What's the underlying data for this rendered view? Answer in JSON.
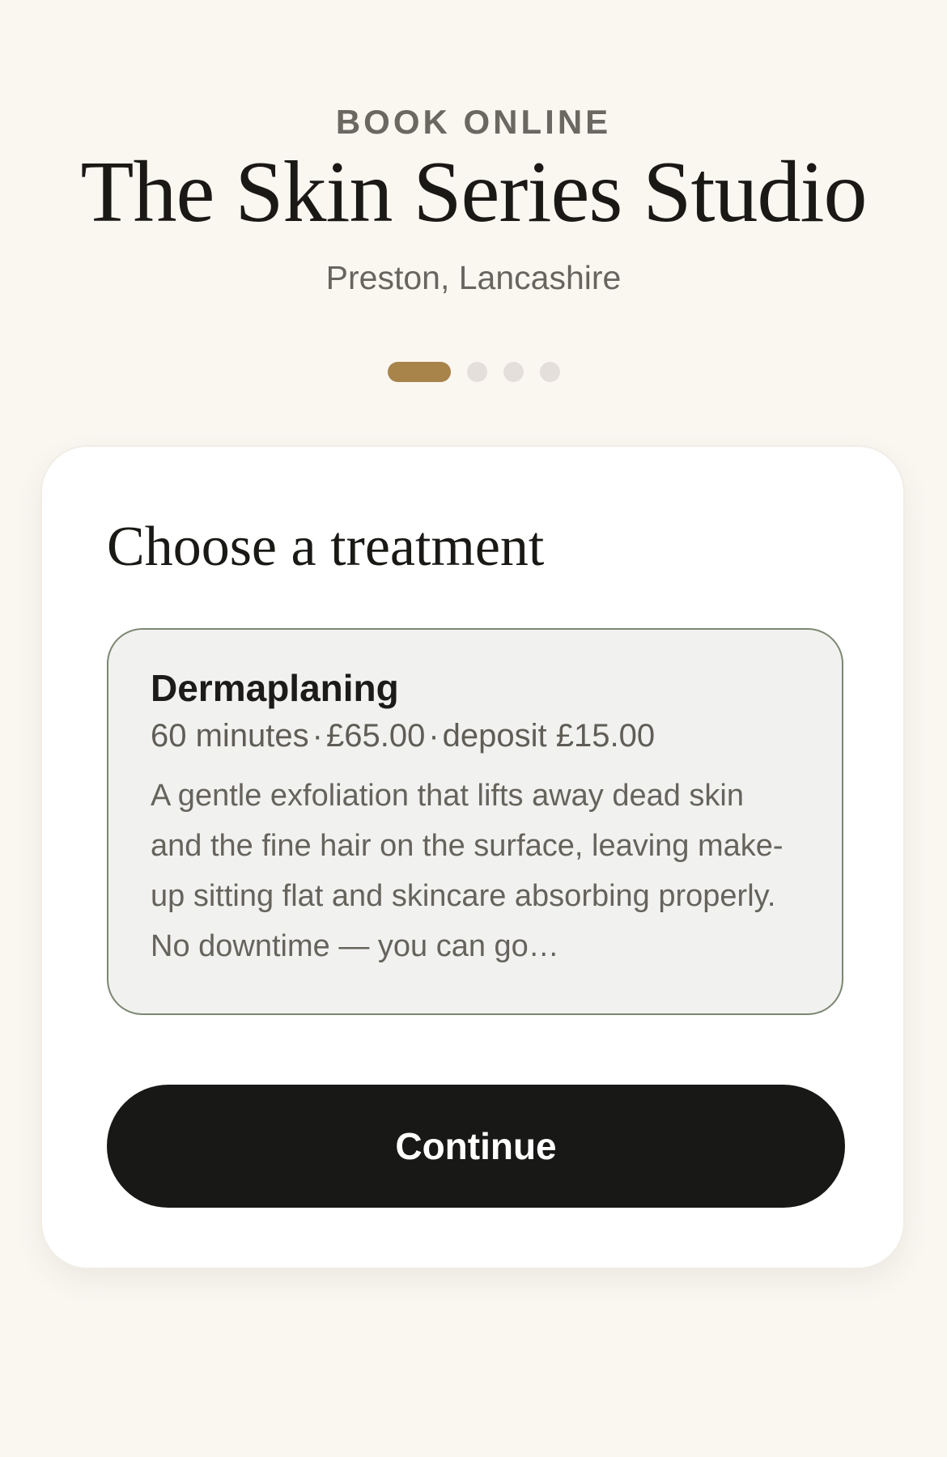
{
  "header": {
    "eyebrow": "BOOK ONLINE",
    "title": "The Skin Series Studio",
    "location": "Preston, Lancashire"
  },
  "stepper": {
    "total_steps": 4,
    "current_step": 1
  },
  "card": {
    "heading": "Choose a treatment",
    "treatment": {
      "name": "Dermaplaning",
      "duration": "60 minutes",
      "price": "£65.00",
      "deposit": "deposit £15.00",
      "separator": "·",
      "description": "A gentle exfoliation that lifts away dead skin and the fine hair on the surface, leaving make-up sitting flat and skincare absorbing properly. No downtime — you can go…",
      "selected": true
    },
    "continue_label": "Continue"
  },
  "colors": {
    "page_background": "#faf7f1",
    "accent": "#a8844b",
    "selected_border": "#7c8672",
    "selected_background": "#f1f2ef",
    "button_background": "#181816"
  }
}
